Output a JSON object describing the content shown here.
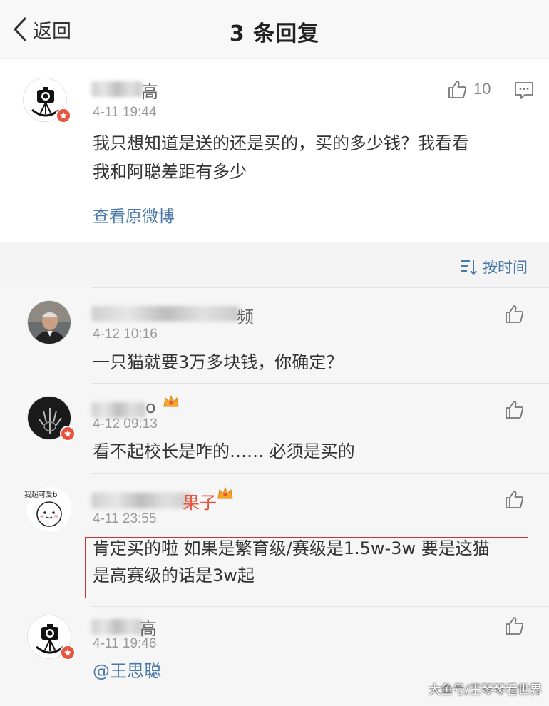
{
  "nav": {
    "back_label": "返回",
    "title": "3 条回复"
  },
  "root": {
    "name_suffix": "高",
    "time": "4-11 19:44",
    "likes": "10",
    "content_line1": "我只想知道是送的还是买的，买的多少钱？我看看",
    "content_line2": "我和阿聪差距有多少",
    "view_original": "查看原微博"
  },
  "sort": {
    "label": "按时间"
  },
  "replies": [
    {
      "name_suffix": "频",
      "time": "4-12 10:16",
      "content": "一只猫就要3万多块钱，你确定？"
    },
    {
      "name_suffix": "o",
      "time": "4-12 09:13",
      "content": "看不起校长是咋的…… 必须是买的"
    },
    {
      "name_suffix": "果子",
      "time": "4-11 23:55",
      "avatar_text": "我超可爱b",
      "content_line1": "肯定买的啦 如果是繁育级/赛级是1.5w-3w 要是这猫",
      "content_line2": "是高赛级的话是3w起"
    },
    {
      "name_suffix": "高",
      "time": "4-11 19:46",
      "content": "@王思聪"
    }
  ],
  "watermark": "大鱼号/王琴琴看世界",
  "colors": {
    "link": "#4a7aa8",
    "badge": "#e8533f",
    "highlight_border": "#cc3333"
  }
}
